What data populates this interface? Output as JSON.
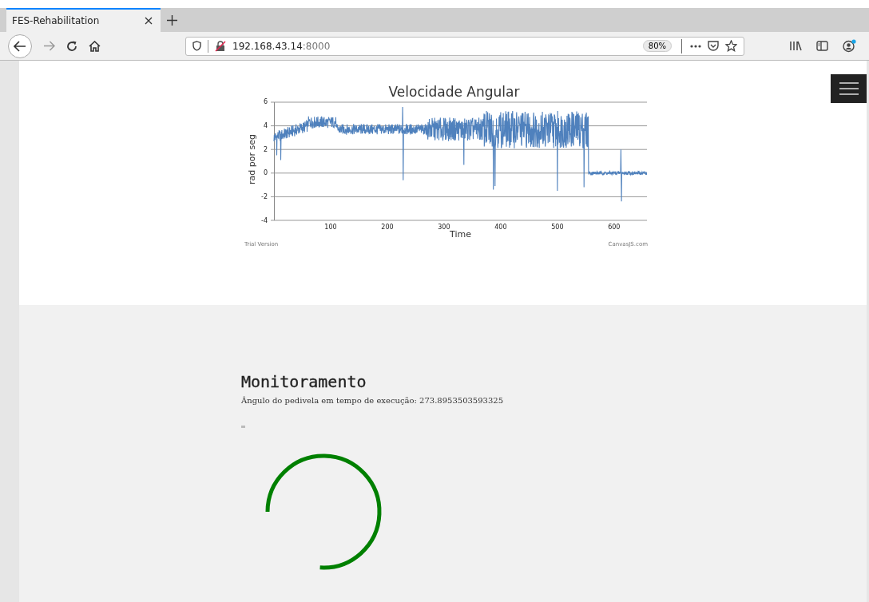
{
  "browser": {
    "tab": {
      "title": "FES-Rehabilitation",
      "selected": true
    },
    "address": {
      "host": "192.168.43.14",
      "port": ":8000"
    },
    "zoom": "80%"
  },
  "chart": {
    "title": "Velocidade Angular",
    "xlabel": "Time",
    "ylabel": "rad por seg",
    "xticks": [
      "100",
      "200",
      "300",
      "400",
      "500",
      "600"
    ],
    "yticks": [
      "6",
      "4",
      "2",
      "0",
      "-2",
      "-4"
    ],
    "trial_note": "Trial Version",
    "credit": "CanvasJS.com"
  },
  "monitor": {
    "heading": "Monitoramento",
    "reading": "Ângulo do pedivela em tempo de execução: 273.8953503593325"
  }
}
